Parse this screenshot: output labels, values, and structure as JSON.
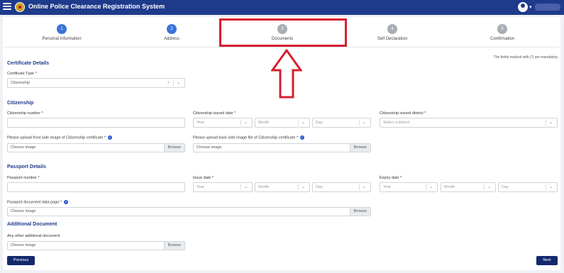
{
  "app": {
    "title": "Online Police Clearance Registration System"
  },
  "colors": {
    "header": "#1e3a8a",
    "accent": "#3b73d9",
    "highlight": "#d51f2f",
    "button": "#14296d"
  },
  "steps": [
    {
      "num": "1",
      "label": "Personal Information",
      "status": "complete"
    },
    {
      "num": "2",
      "label": "Address",
      "status": "complete"
    },
    {
      "num": "3",
      "label": "Documents",
      "status": "current"
    },
    {
      "num": "4",
      "label": "Self Declaration",
      "status": "pending"
    },
    {
      "num": "5",
      "label": "Confirmation",
      "status": "pending"
    }
  ],
  "note": "The fields marked with (*) are mandatory.",
  "certificate": {
    "title": "Certificate Details",
    "type_label": "Certificate Type *",
    "type_value": "Citizenship"
  },
  "citizenship": {
    "title": "Citizenship",
    "number_label": "Citizenship number *",
    "issued_date_label": "Citizenship issued date *",
    "year": "Year",
    "month": "Month",
    "day": "Day",
    "district_label": "Citizenship issued district *",
    "district_placeholder": "Select a district",
    "front_label": "Please upload front side image of Citizenship certificate *",
    "back_label": "Please upload back side image file of Citizenship certificate *"
  },
  "upload": {
    "placeholder": "Choose image",
    "browse": "Browse"
  },
  "passport": {
    "title": "Passport Details",
    "number_label": "Passport number *",
    "issue_label": "Issue date *",
    "expiry_label": "Expiry date *",
    "year": "Year",
    "month": "Month",
    "day": "Day",
    "data_page_label": "Passport document data page *"
  },
  "additional": {
    "title": "Additional Document",
    "other_label": "Any other additional document"
  },
  "buttons": {
    "previous": "Previous",
    "next": "Next"
  },
  "icons": {
    "menu": "menu-icon",
    "info": "info-icon",
    "chevron": "chevron-down-icon",
    "user": "user-icon"
  }
}
